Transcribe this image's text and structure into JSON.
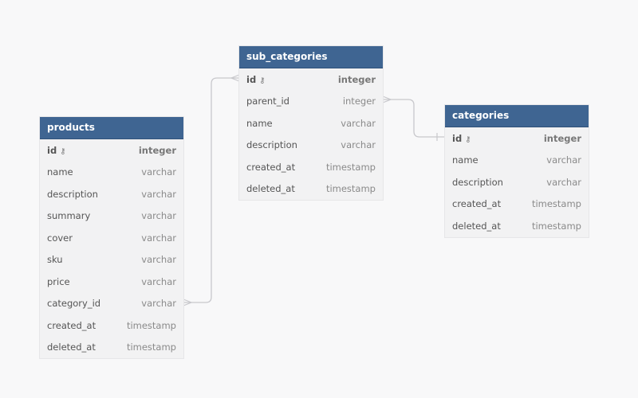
{
  "tables": [
    {
      "name": "products",
      "columns": [
        {
          "name": "id",
          "type": "integer",
          "pk": true
        },
        {
          "name": "name",
          "type": "varchar"
        },
        {
          "name": "description",
          "type": "varchar"
        },
        {
          "name": "summary",
          "type": "varchar"
        },
        {
          "name": "cover",
          "type": "varchar"
        },
        {
          "name": "sku",
          "type": "varchar"
        },
        {
          "name": "price",
          "type": "varchar"
        },
        {
          "name": "category_id",
          "type": "varchar"
        },
        {
          "name": "created_at",
          "type": "timestamp"
        },
        {
          "name": "deleted_at",
          "type": "timestamp"
        }
      ]
    },
    {
      "name": "sub_categories",
      "columns": [
        {
          "name": "id",
          "type": "integer",
          "pk": true
        },
        {
          "name": "parent_id",
          "type": "integer"
        },
        {
          "name": "name",
          "type": "varchar"
        },
        {
          "name": "description",
          "type": "varchar"
        },
        {
          "name": "created_at",
          "type": "timestamp"
        },
        {
          "name": "deleted_at",
          "type": "timestamp"
        }
      ]
    },
    {
      "name": "categories",
      "columns": [
        {
          "name": "id",
          "type": "integer",
          "pk": true
        },
        {
          "name": "name",
          "type": "varchar"
        },
        {
          "name": "description",
          "type": "varchar"
        },
        {
          "name": "created_at",
          "type": "timestamp"
        },
        {
          "name": "deleted_at",
          "type": "timestamp"
        }
      ]
    }
  ],
  "relations": [
    {
      "from": "products.category_id",
      "to": "sub_categories.id"
    },
    {
      "from": "sub_categories.parent_id",
      "to": "categories.id"
    }
  ],
  "colors": {
    "header": "#3f6592",
    "body": "#f2f2f3",
    "canvas": "#f8f8f9",
    "link": "#c8c8cc"
  }
}
